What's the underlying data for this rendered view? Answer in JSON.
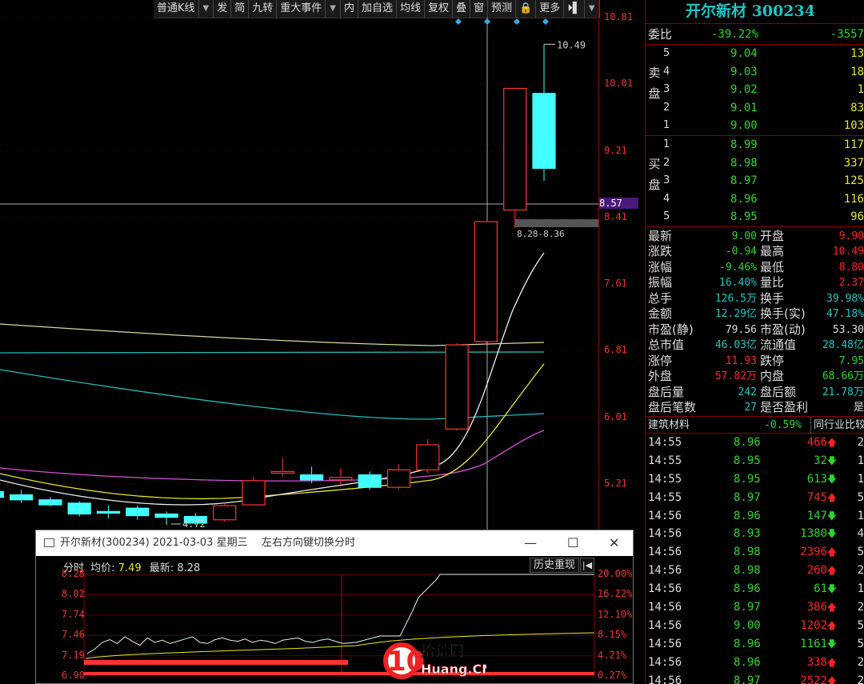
{
  "toolbar": {
    "items": [
      "普通K线",
      "▼",
      "发",
      "简",
      "九转",
      "重大事件",
      "▼",
      "内",
      "加自选",
      "均线",
      "复权",
      "叠",
      "窗",
      "预测",
      "🔒",
      "更多",
      "⏵▌",
      "▼"
    ]
  },
  "kline": {
    "y_labels": [
      "10.81",
      "10.01",
      "9.21",
      "8.57",
      "8.41",
      "7.61",
      "6.81",
      "6.01",
      "5.21"
    ],
    "highlight_label": "8.57",
    "annot_high": "10.49",
    "annot_low": "4.72",
    "annot_range": "8.28-8.36"
  },
  "chart_data": {
    "type": "candlestick",
    "ylim": [
      4.4,
      10.81
    ],
    "candles": [
      {
        "o": 5.12,
        "c": 5.05,
        "h": 5.15,
        "l": 5.0
      },
      {
        "o": 5.08,
        "c": 5.02,
        "h": 5.14,
        "l": 4.98
      },
      {
        "o": 5.02,
        "c": 4.96,
        "h": 5.05,
        "l": 4.94
      },
      {
        "o": 4.98,
        "c": 4.85,
        "h": 5.0,
        "l": 4.82
      },
      {
        "o": 4.88,
        "c": 4.86,
        "h": 4.95,
        "l": 4.8
      },
      {
        "o": 4.92,
        "c": 4.83,
        "h": 4.95,
        "l": 4.78
      },
      {
        "o": 4.85,
        "c": 4.81,
        "h": 4.88,
        "l": 4.72
      },
      {
        "o": 4.82,
        "c": 4.74,
        "h": 4.86,
        "l": 4.72
      },
      {
        "o": 4.78,
        "c": 4.95,
        "h": 4.97,
        "l": 4.76
      },
      {
        "o": 4.96,
        "c": 5.25,
        "h": 5.3,
        "l": 4.95
      },
      {
        "o": 5.34,
        "c": 5.36,
        "h": 5.52,
        "l": 5.3
      },
      {
        "o": 5.32,
        "c": 5.26,
        "h": 5.42,
        "l": 5.22
      },
      {
        "o": 5.26,
        "c": 5.29,
        "h": 5.4,
        "l": 5.2
      },
      {
        "o": 5.32,
        "c": 5.17,
        "h": 5.36,
        "l": 5.14
      },
      {
        "o": 5.17,
        "c": 5.38,
        "h": 5.45,
        "l": 5.15
      },
      {
        "o": 5.38,
        "c": 5.68,
        "h": 5.75,
        "l": 5.34
      },
      {
        "o": 5.87,
        "c": 6.88,
        "h": 6.9,
        "l": 5.85
      },
      {
        "o": 6.92,
        "c": 8.36,
        "h": 8.36,
        "l": 6.88
      },
      {
        "o": 8.5,
        "c": 9.96,
        "h": 9.96,
        "l": 8.28
      },
      {
        "o": 9.9,
        "c": 9.0,
        "h": 10.49,
        "l": 8.85
      }
    ]
  },
  "stock": {
    "title": "开尔新材 300234"
  },
  "orderbook": {
    "ratio_label": "委比",
    "ratio_value": "-39.22%",
    "ratio_diff": "-3557",
    "sell_label": [
      "卖",
      "盘"
    ],
    "buy_label": [
      "买",
      "盘"
    ],
    "sell": [
      {
        "lv": "5",
        "price": "9.04",
        "vol": "13"
      },
      {
        "lv": "4",
        "price": "9.03",
        "vol": "18"
      },
      {
        "lv": "3",
        "price": "9.02",
        "vol": "1"
      },
      {
        "lv": "2",
        "price": "9.01",
        "vol": "83"
      },
      {
        "lv": "1",
        "price": "9.00",
        "vol": "103"
      }
    ],
    "buy": [
      {
        "lv": "1",
        "price": "8.99",
        "vol": "117"
      },
      {
        "lv": "2",
        "price": "8.98",
        "vol": "337"
      },
      {
        "lv": "3",
        "price": "8.97",
        "vol": "125"
      },
      {
        "lv": "4",
        "price": "8.96",
        "vol": "116"
      },
      {
        "lv": "5",
        "price": "8.95",
        "vol": "96"
      }
    ]
  },
  "quote": [
    {
      "l1": "最新",
      "v1": "9.00",
      "c1": "green",
      "l2": "开盘",
      "v2": "9.90",
      "c2": "red"
    },
    {
      "l1": "涨跌",
      "v1": "-0.94",
      "c1": "green",
      "l2": "最高",
      "v2": "10.49",
      "c2": "red"
    },
    {
      "l1": "涨幅",
      "v1": "-9.46%",
      "c1": "green",
      "l2": "最低",
      "v2": "8.80",
      "c2": "red"
    },
    {
      "l1": "振幅",
      "v1": "16.40%",
      "c1": "cyan",
      "l2": "量比",
      "v2": "2.37",
      "c2": "red"
    },
    {
      "l1": "总手",
      "v1": "126.5万",
      "c1": "cyan",
      "l2": "换手",
      "v2": "39.98%",
      "c2": "cyan"
    },
    {
      "l1": "金额",
      "v1": "12.29亿",
      "c1": "cyan",
      "l2": "换手(实)",
      "v2": "47.18%",
      "c2": "cyan"
    },
    {
      "l1": "市盈(静)",
      "v1": "79.56",
      "c1": "white",
      "l2": "市盈(动)",
      "v2": "53.30",
      "c2": "white"
    },
    {
      "l1": "总市值",
      "v1": "46.03亿",
      "c1": "cyan",
      "l2": "流通值",
      "v2": "28.48亿",
      "c2": "cyan"
    },
    {
      "l1": "涨停",
      "v1": "11.93",
      "c1": "red",
      "l2": "跌停",
      "v2": "7.95",
      "c2": "green"
    },
    {
      "l1": "外盘",
      "v1": "57.82万",
      "c1": "red",
      "l2": "内盘",
      "v2": "68.66万",
      "c2": "green"
    },
    {
      "l1": "盘后量",
      "v1": "242",
      "c1": "cyan",
      "l2": "盘后额",
      "v2": "21.78万",
      "c2": "cyan"
    },
    {
      "l1": "盘后笔数",
      "v1": "27",
      "c1": "cyan",
      "l2": "是否盈利",
      "v2": "是",
      "c2": "white"
    }
  ],
  "sector": {
    "name": "建筑材料",
    "pct": "-0.59%",
    "btn": "同行业比较"
  },
  "ticks": [
    {
      "t": "14:55",
      "p": "8.96",
      "pc": "green",
      "v": "466",
      "vc": "red",
      "a": "up",
      "n": "2"
    },
    {
      "t": "14:55",
      "p": "8.95",
      "pc": "green",
      "v": "32",
      "vc": "green",
      "a": "down",
      "n": "1"
    },
    {
      "t": "14:55",
      "p": "8.95",
      "pc": "green",
      "v": "613",
      "vc": "green",
      "a": "down",
      "n": "1"
    },
    {
      "t": "14:55",
      "p": "8.97",
      "pc": "green",
      "v": "745",
      "vc": "red",
      "a": "up",
      "n": "5"
    },
    {
      "t": "14:56",
      "p": "8.96",
      "pc": "green",
      "v": "147",
      "vc": "green",
      "a": "down",
      "n": "1"
    },
    {
      "t": "14:56",
      "p": "8.93",
      "pc": "green",
      "v": "1380",
      "vc": "green",
      "a": "down",
      "n": "4"
    },
    {
      "t": "14:56",
      "p": "8.98",
      "pc": "green",
      "v": "2396",
      "vc": "red",
      "a": "up",
      "n": "5"
    },
    {
      "t": "14:56",
      "p": "8.98",
      "pc": "green",
      "v": "260",
      "vc": "red",
      "a": "up",
      "n": "2"
    },
    {
      "t": "14:56",
      "p": "8.96",
      "pc": "green",
      "v": "61",
      "vc": "green",
      "a": "down",
      "n": "1"
    },
    {
      "t": "14:56",
      "p": "8.97",
      "pc": "green",
      "v": "386",
      "vc": "red",
      "a": "up",
      "n": "2"
    },
    {
      "t": "14:56",
      "p": "9.00",
      "pc": "green",
      "v": "1202",
      "vc": "red",
      "a": "up",
      "n": "5"
    },
    {
      "t": "14:56",
      "p": "8.96",
      "pc": "green",
      "v": "1161",
      "vc": "green",
      "a": "down",
      "n": "5"
    },
    {
      "t": "14:56",
      "p": "8.96",
      "pc": "green",
      "v": "338",
      "vc": "red",
      "a": "up",
      "n": "2"
    },
    {
      "t": "14:56",
      "p": "8.97",
      "pc": "green",
      "v": "2522",
      "vc": "red",
      "a": "up",
      "n": "2"
    }
  ],
  "popup": {
    "title": "开尔新材(300234) 2021-03-03 星期三",
    "hint": "左右方向键切换分时",
    "info_label": "分时",
    "avg_label": "均价:",
    "avg_value": "7.49",
    "last_label": "最新:",
    "last_value": "8.28",
    "history_btn": "历史重现",
    "left_labels": [
      "8.28",
      "8.02",
      "7.74",
      "7.46",
      "7.19",
      "6.90"
    ],
    "right_labels": [
      "20.00%",
      "16.22%",
      "12.10%",
      "8.15%",
      "4.21%",
      "0.27%"
    ]
  },
  "watermark": {
    "num": "10",
    "cn": "拾荒网",
    "en": "Huang.CN"
  }
}
